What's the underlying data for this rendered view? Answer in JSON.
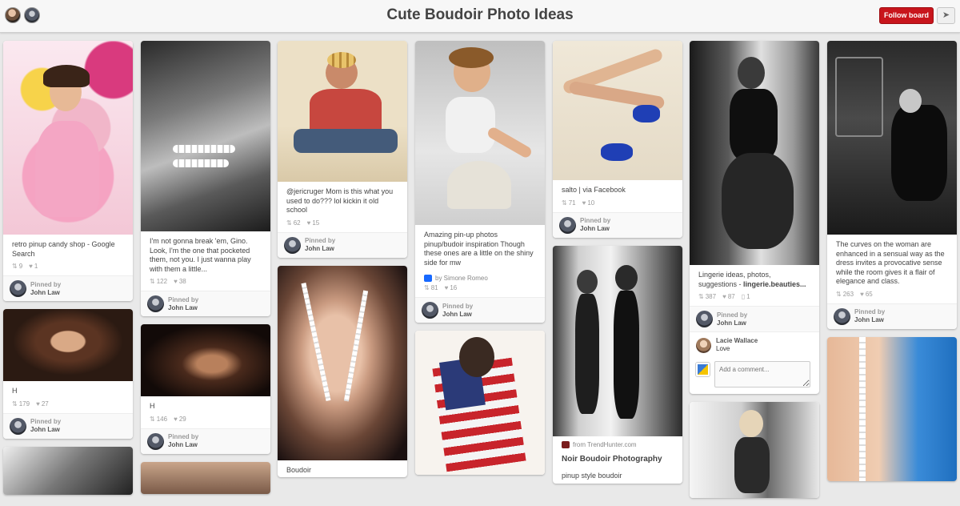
{
  "header": {
    "title": "Cute Boudoir Photo Ideas",
    "follow_label": "Follow board",
    "send_icon": "paper-plane-icon",
    "accent": "#c8151c"
  },
  "pins": [
    {
      "desc": "retro pinup candy shop - Google Search",
      "repins": "9",
      "likes": "1",
      "pinned_by": "Pinned by",
      "pinner": "John Law"
    },
    {
      "desc": "H",
      "repins": "179",
      "likes": "27",
      "pinned_by": "Pinned by",
      "pinner": "John Law"
    },
    {
      "desc": "I'm not gonna break 'em, Gino. Look, I'm the one that pocketed them, not you. I just wanna play with them a little...",
      "repins": "122",
      "likes": "38",
      "pinned_by": "Pinned by",
      "pinner": "John Law"
    },
    {
      "desc": "H",
      "repins": "146",
      "likes": "29",
      "pinned_by": "Pinned by",
      "pinner": "John Law"
    },
    {
      "desc": "@jericruger Mom is this what you used to do??? lol kickin it old school",
      "repins": "62",
      "likes": "15",
      "pinned_by": "Pinned by",
      "pinner": "John Law"
    },
    {
      "desc": "Boudoir"
    },
    {
      "desc": "Amazing pin-up photos pinup/budoir inspiration Though these ones are a little on the shiny side for mw",
      "source_by": "by Simone Romeo",
      "repins": "81",
      "likes": "16",
      "pinned_by": "Pinned by",
      "pinner": "John Law"
    },
    {
      "desc": "salto | via Facebook",
      "repins": "71",
      "likes": "10",
      "pinned_by": "Pinned by",
      "pinner": "John Law"
    },
    {
      "source": "from TrendHunter.com",
      "desc": "Noir Boudoir Photography",
      "desc2": "pinup style boudoir"
    },
    {
      "desc": "Lingerie ideas, photos, suggestions - ",
      "desc_link": "lingerie.beauties...",
      "repins": "387",
      "likes": "87",
      "comments": "1",
      "pinned_by": "Pinned by",
      "pinner": "John Law",
      "commenter": "Lacie Wallace",
      "comment": "Love",
      "comment_placeholder": "Add a comment..."
    },
    {
      "desc": "The curves on the woman are enhanced in a sensual way as the dress invites a provocative sense while the room gives it a flair of elegance and class.",
      "repins": "263",
      "likes": "65",
      "pinned_by": "Pinned by",
      "pinner": "John Law"
    }
  ]
}
